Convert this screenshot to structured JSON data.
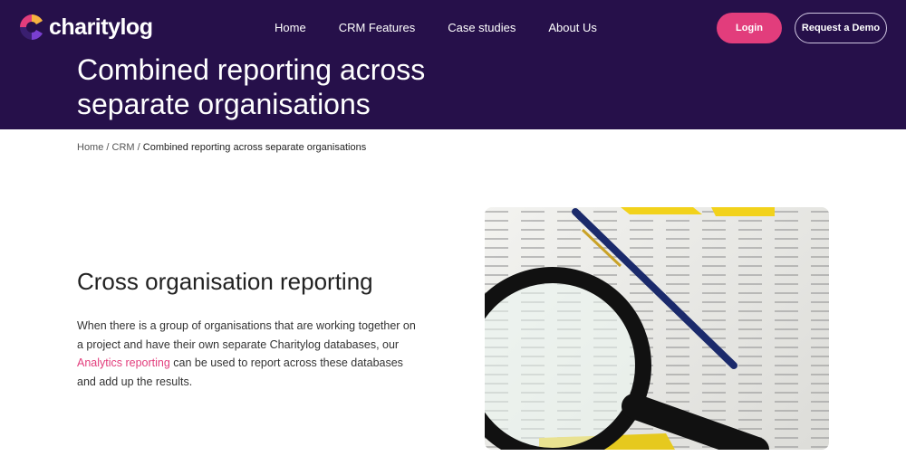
{
  "brand": {
    "name": "charitylog"
  },
  "nav": {
    "items": [
      "Home",
      "CRM Features",
      "Case studies",
      "About Us"
    ],
    "login": "Login",
    "demo": "Request a Demo"
  },
  "hero": {
    "title_line1": "Combined reporting across",
    "title_line2": "separate organisations"
  },
  "breadcrumb": {
    "home": "Home",
    "crm": "CRM",
    "current": "Combined reporting across separate organisations",
    "sep": "/"
  },
  "section": {
    "heading": "Cross organisation reporting",
    "text_before": "When there is a group of organisations that are working together on a project and have their own separate Charitylog databases, our ",
    "link": "Analytics reporting",
    "text_after": " can be used to report across these databases and add up the results."
  },
  "colors": {
    "brand": "#26104a",
    "accent": "#e23d7c"
  }
}
